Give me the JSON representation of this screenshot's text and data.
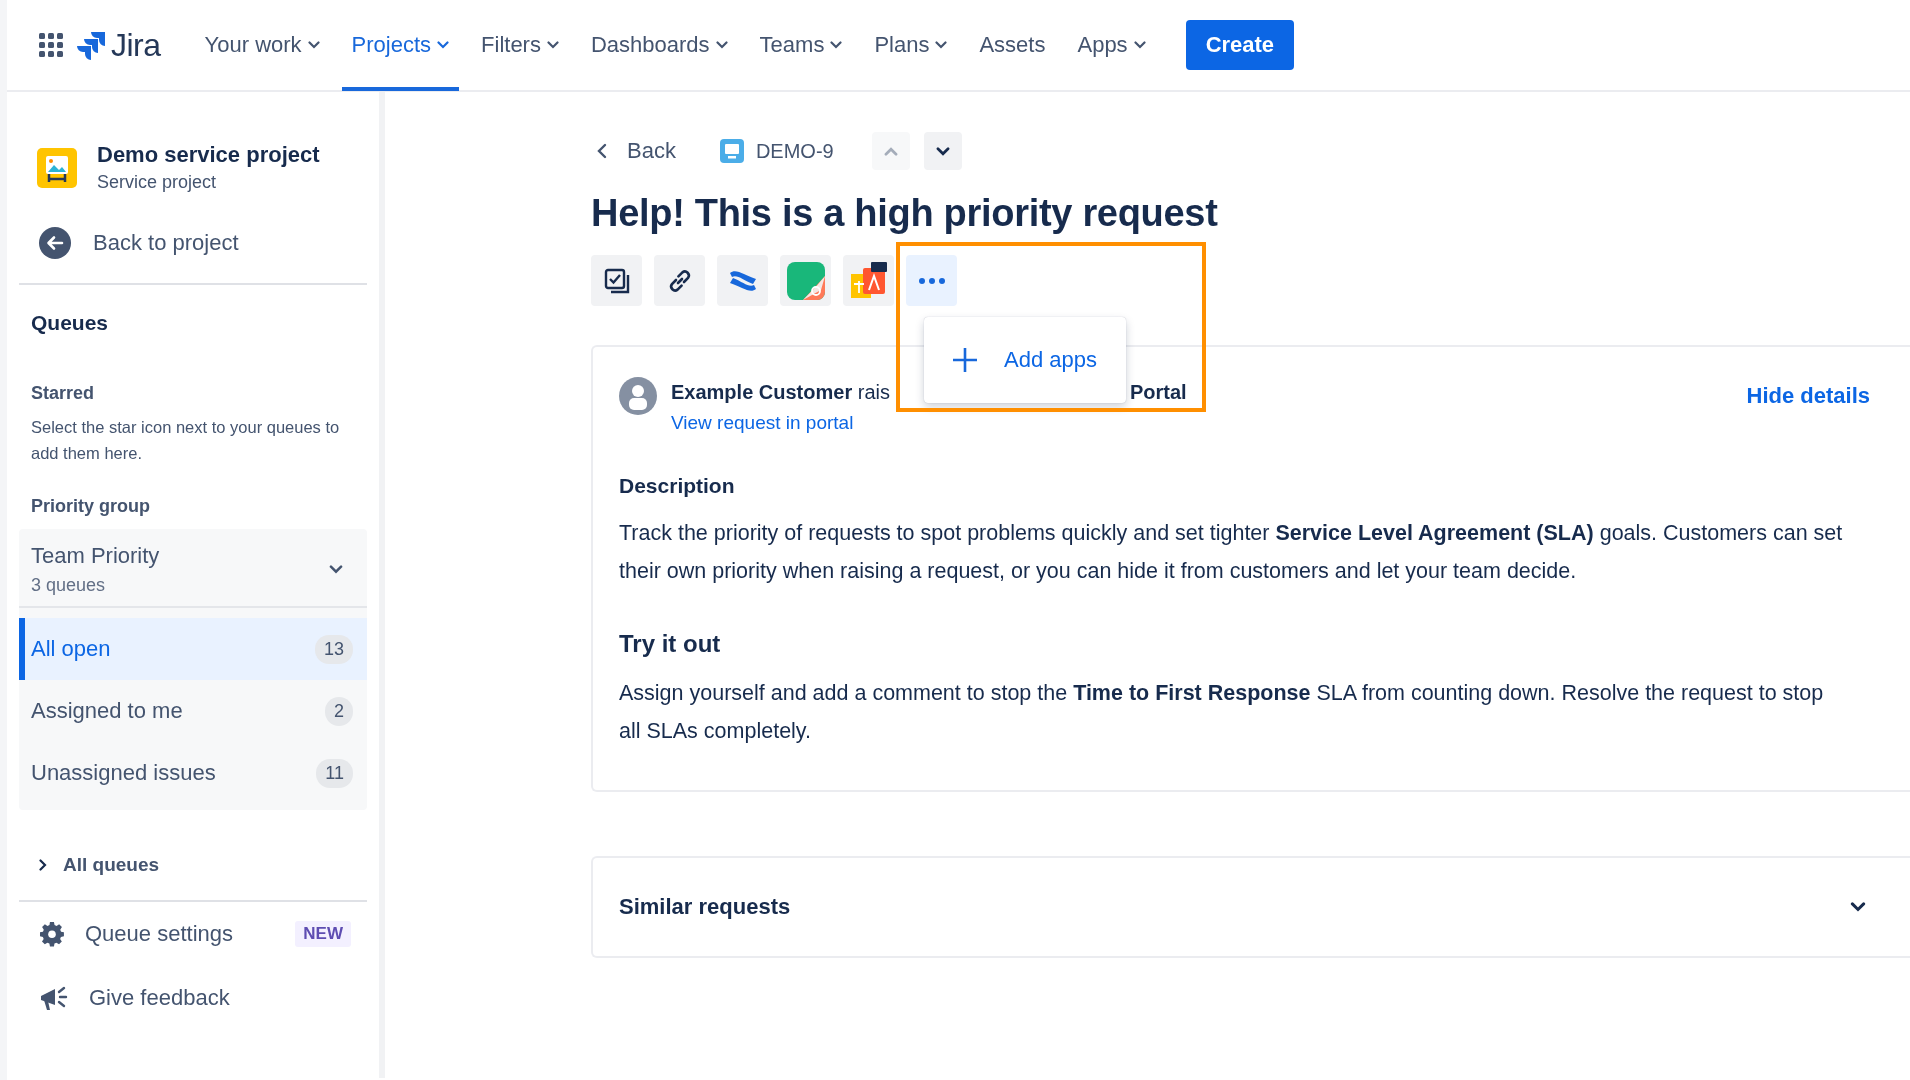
{
  "topnav": {
    "logo": "Jira",
    "items": [
      {
        "label": "Your work",
        "dropdown": true,
        "selected": false
      },
      {
        "label": "Projects",
        "dropdown": true,
        "selected": true
      },
      {
        "label": "Filters",
        "dropdown": true,
        "selected": false
      },
      {
        "label": "Dashboards",
        "dropdown": true,
        "selected": false
      },
      {
        "label": "Teams",
        "dropdown": true,
        "selected": false
      },
      {
        "label": "Plans",
        "dropdown": true,
        "selected": false
      },
      {
        "label": "Assets",
        "dropdown": false,
        "selected": false
      },
      {
        "label": "Apps",
        "dropdown": true,
        "selected": false
      }
    ],
    "create_button": "Create"
  },
  "sidebar": {
    "project_name": "Demo service project",
    "project_type": "Service project",
    "back_link": "Back to project",
    "queues_heading": "Queues",
    "starred_heading": "Starred",
    "starred_hint": "Select the star icon next to your queues to add them here.",
    "group_heading": "Priority group",
    "group": {
      "name": "Team Priority",
      "count": "3 queues",
      "expanded": true,
      "queues": [
        {
          "label": "All open",
          "count": "13",
          "selected": true
        },
        {
          "label": "Assigned to me",
          "count": "2",
          "selected": false
        },
        {
          "label": "Unassigned issues",
          "count": "11",
          "selected": false
        }
      ]
    },
    "all_queues": "All queues",
    "expanded": false,
    "footer": [
      {
        "kind": "settings",
        "label": "Queue settings",
        "badge": "NEW"
      },
      {
        "kind": "feedback",
        "label": "Give feedback"
      }
    ]
  },
  "issue": {
    "back": "Back",
    "key": "DEMO-9",
    "nav_buttons": [
      {
        "kind": "up",
        "disabled": true
      },
      {
        "kind": "down",
        "disabled": false
      }
    ],
    "title": "Help! This is a high priority request",
    "toolbar": [
      {
        "kind": "checklist"
      },
      {
        "kind": "link"
      },
      {
        "kind": "confluence"
      },
      {
        "kind": "hubspot"
      },
      {
        "kind": "translate"
      },
      {
        "kind": "more"
      }
    ],
    "menu": {
      "open": true,
      "items": [
        "Add apps"
      ]
    },
    "reporter_left": "**Example Customer** rais",
    "reporter_right": "Portal",
    "portal_link": "View request in portal",
    "hide_details": "Hide details",
    "description_heading": "Description",
    "description": "Track the priority of requests to spot problems quickly and set tighter **Service Level Agreement (SLA)** goals. Customers can set their own priority when raising a request, or you can hide it from customers and let your team decide.",
    "try_heading": "Try it out",
    "try_text": "Assign yourself and add a comment to stop the **Time to First Response** SLA from counting down. Resolve the request to stop all SLAs completely.",
    "similar": {
      "label": "Similar requests",
      "expanded": false
    }
  }
}
